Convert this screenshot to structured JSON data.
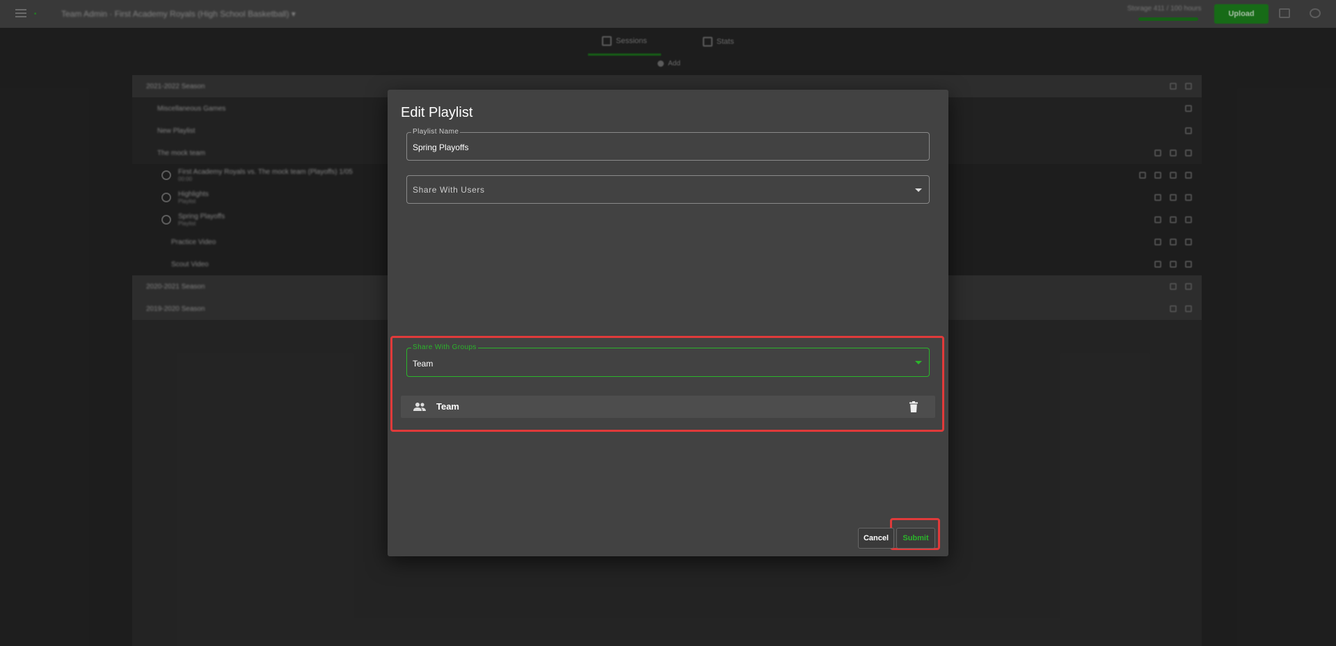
{
  "app": {
    "breadcrumb": "Team Admin · First Academy Royals (High School Basketball) ▾",
    "storage_text": "Storage 411 / 100 hours",
    "upload_label": "Upload",
    "brand_color": "#2bb52b"
  },
  "tabs": [
    {
      "label": "Sessions"
    },
    {
      "label": "Stats"
    }
  ],
  "sub_label": "Add",
  "background_rows": [
    {
      "text": "2021-2022 Season",
      "kind": "season"
    },
    {
      "text": "Miscellaneous Games",
      "kind": "games"
    },
    {
      "text": "New Playlist",
      "kind": "games"
    },
    {
      "text": "The mock team",
      "kind": "games"
    },
    {
      "text": "First Academy Royals vs. The mock team (Playoffs) 1/05",
      "sub": "00:00",
      "kind": "dark"
    },
    {
      "text": "Highlights",
      "sub": "Playlist",
      "kind": "dark"
    },
    {
      "text": "Spring Playoffs",
      "sub": "Playlist",
      "kind": "dark"
    },
    {
      "text": "Practice Video",
      "kind": "dark"
    },
    {
      "text": "Scout Video",
      "kind": "dark"
    },
    {
      "text": "2020-2021 Season",
      "kind": "season"
    },
    {
      "text": "2019-2020 Season",
      "kind": "season"
    }
  ],
  "dialog": {
    "title": "Edit Playlist",
    "playlist_name_label": "Playlist Name",
    "playlist_name_value": "Spring Playoffs",
    "share_users_placeholder": "Share With Users",
    "share_groups_label": "Share With Groups",
    "share_groups_value": "Team",
    "groups": [
      {
        "name": "Team",
        "icon": "group-icon"
      }
    ],
    "cancel_label": "Cancel",
    "submit_label": "Submit"
  }
}
